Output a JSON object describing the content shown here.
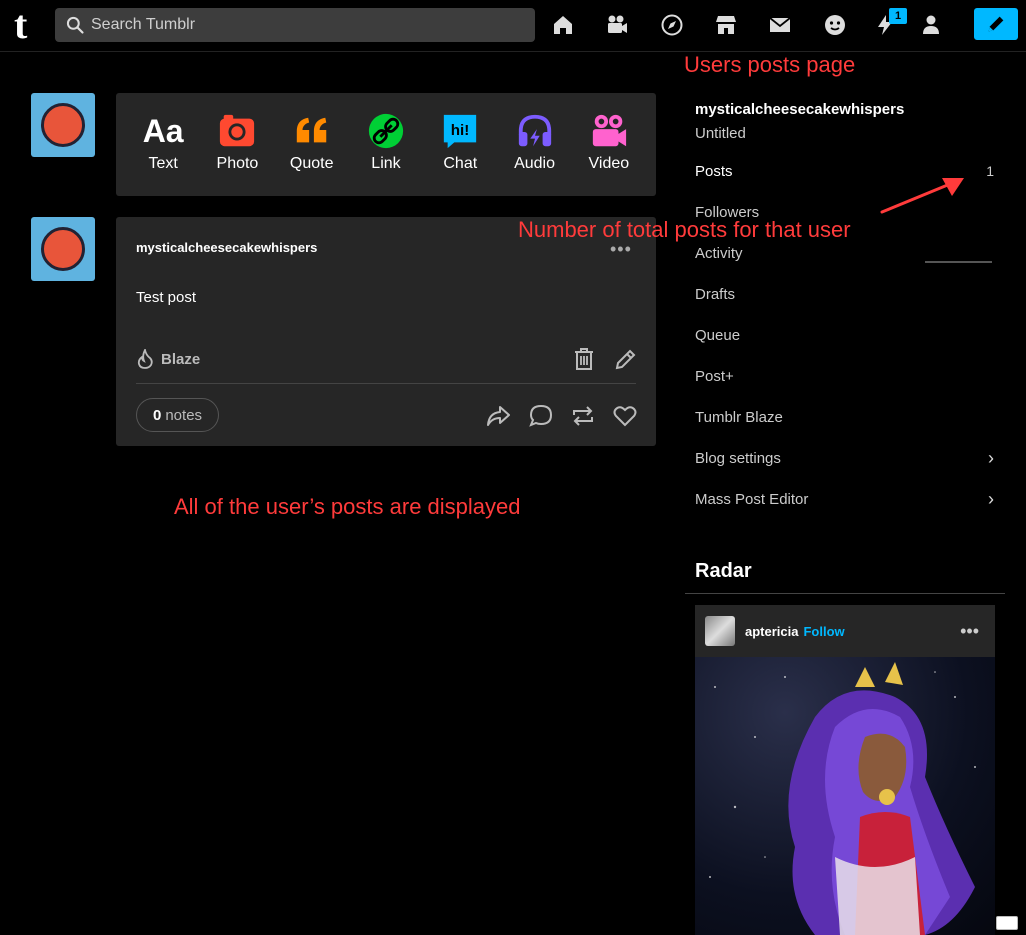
{
  "topbar": {
    "logo": "t",
    "search_placeholder": "Search Tumblr",
    "notification_count": "1"
  },
  "composer": {
    "types": [
      {
        "label": "Text",
        "icon": "text-icon",
        "color": "#ffffff"
      },
      {
        "label": "Photo",
        "icon": "camera-icon",
        "color": "#ff4930"
      },
      {
        "label": "Quote",
        "icon": "quote-icon",
        "color": "#ff8a00"
      },
      {
        "label": "Link",
        "icon": "link-icon",
        "color": "#00cf35"
      },
      {
        "label": "Chat",
        "icon": "chat-icon",
        "color": "#00b8ff"
      },
      {
        "label": "Audio",
        "icon": "headphones-icon",
        "color": "#7c5cff"
      },
      {
        "label": "Video",
        "icon": "video-camera-icon",
        "color": "#ff62ce"
      }
    ]
  },
  "post": {
    "author": "mysticalcheesecakewhispers",
    "body": "Test post",
    "blaze_label": "Blaze",
    "notes_count": "0",
    "notes_label": "notes"
  },
  "sidebar": {
    "blog_name": "mysticalcheesecakewhispers",
    "blog_subtitle": "Untitled",
    "items": [
      {
        "label": "Posts",
        "count": "1"
      },
      {
        "label": "Followers"
      },
      {
        "label": "Activity"
      },
      {
        "label": "Drafts"
      },
      {
        "label": "Queue"
      },
      {
        "label": "Post+"
      },
      {
        "label": "Tumblr Blaze"
      },
      {
        "label": "Blog settings"
      },
      {
        "label": "Mass Post Editor"
      }
    ],
    "chevron": "›"
  },
  "radar": {
    "title": "Radar",
    "user": "aptericia",
    "follow_label": "Follow",
    "more": "•••"
  },
  "annotations": {
    "page_label": "Users posts page",
    "count_label": "Number of total posts for that user",
    "posts_label": "All of the user’s posts are displayed",
    "color": "#ff3b3b"
  }
}
